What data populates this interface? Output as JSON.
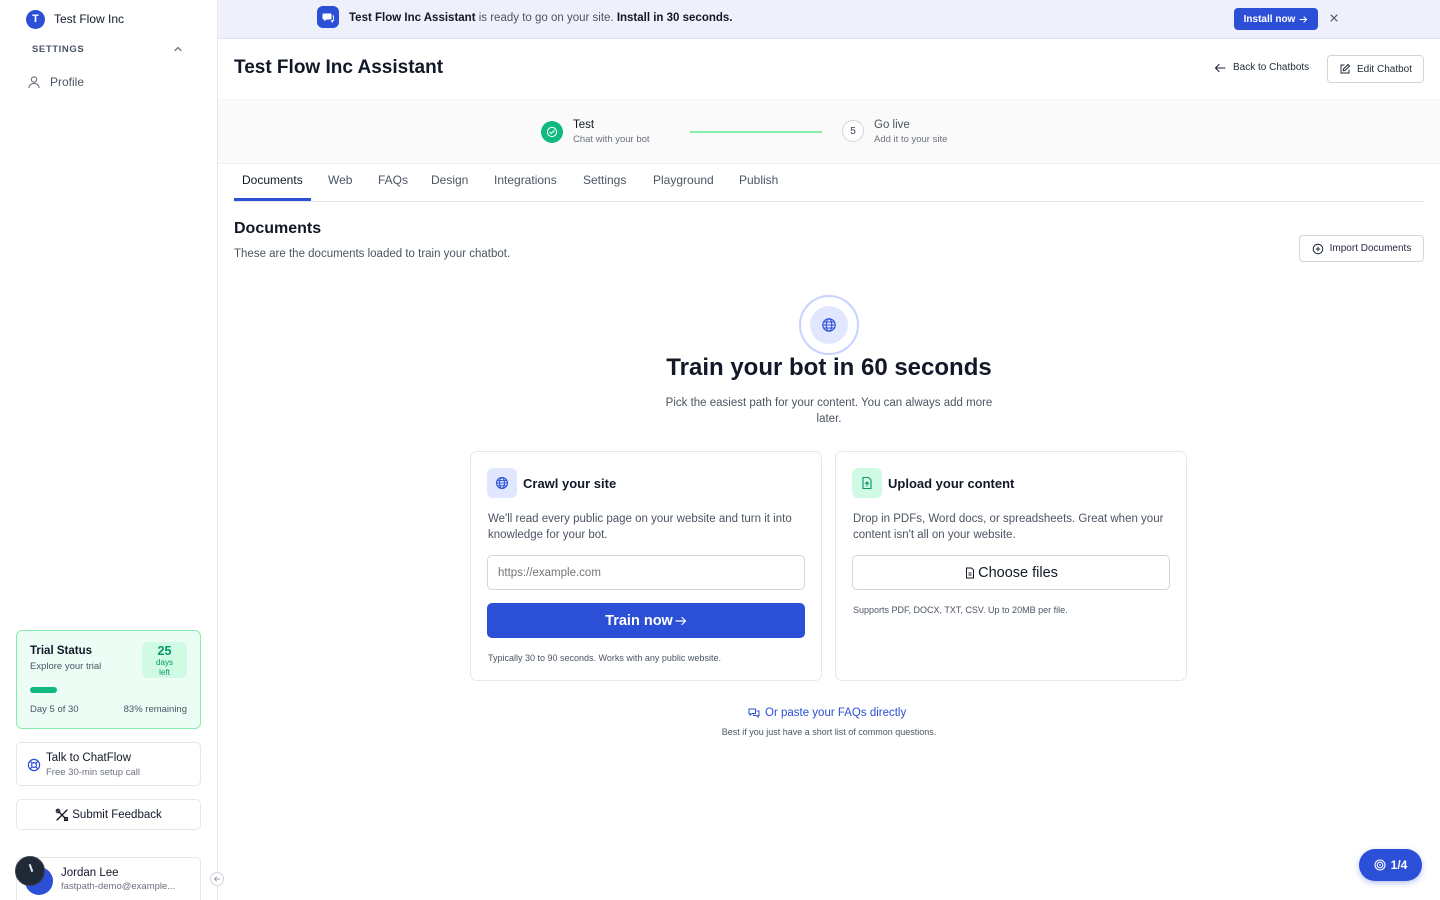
{
  "sidebar": {
    "org_initial": "T",
    "org_name": "Test Flow Inc",
    "settings_label": "SETTINGS",
    "profile_label": "Profile",
    "trial": {
      "title": "Trial Status",
      "subtitle": "Explore your trial",
      "days_number": "25",
      "days_label_1": "days",
      "days_label_2": "left",
      "progress_fraction": 0.167,
      "day_text": "Day 5 of 30",
      "remaining_text": "83% remaining"
    },
    "talk": {
      "title": "Talk to ChatFlow",
      "subtitle": "Free 30-min setup call"
    },
    "feedback_label": "Submit Feedback",
    "user": {
      "name": "Jordan Lee",
      "email": "fastpath-demo@example..."
    }
  },
  "banner": {
    "bot_name": "Test Flow Inc Assistant",
    "middle": " is ready to go on your site. ",
    "cta_text": "Install in 30 seconds.",
    "install_label": "Install now"
  },
  "header": {
    "title": "Test Flow Inc Assistant",
    "back_label": "Back to Chatbots",
    "edit_label": "Edit Chatbot"
  },
  "stepper": {
    "step1": {
      "title": "Test",
      "subtitle": "Chat with your bot"
    },
    "step2": {
      "number": "5",
      "title": "Go live",
      "subtitle": "Add it to your site"
    }
  },
  "tabs": [
    "Documents",
    "Web",
    "FAQs",
    "Design",
    "Integrations",
    "Settings",
    "Playground",
    "Publish"
  ],
  "documents": {
    "title": "Documents",
    "subtitle": "These are the documents loaded to train your chatbot.",
    "import_label": "Import Documents"
  },
  "hero": {
    "title": "Train your bot in 60 seconds",
    "subtitle": "Pick the easiest path for your content. You can always add more later."
  },
  "crawl_card": {
    "title": "Crawl your site",
    "description": "We'll read every public page on your website and turn it into knowledge for your bot.",
    "url_placeholder": "https://example.com",
    "button_label": "Train now",
    "note": "Typically 30 to 90 seconds. Works with any public website."
  },
  "upload_card": {
    "title": "Upload your content",
    "description": "Drop in PDFs, Word docs, or spreadsheets. Great when your content isn't all on your website.",
    "button_label": "Choose files",
    "note": "Supports PDF, DOCX, TXT, CSV. Up to 20MB per file."
  },
  "faq": {
    "link_label": "Or paste your FAQs directly",
    "note": "Best if you just have a short list of common questions."
  },
  "pager": {
    "label": "1/4"
  },
  "colors": {
    "primary": "#2c4fd8",
    "success": "#10b981",
    "trial_bg": "#ecfdf5"
  }
}
